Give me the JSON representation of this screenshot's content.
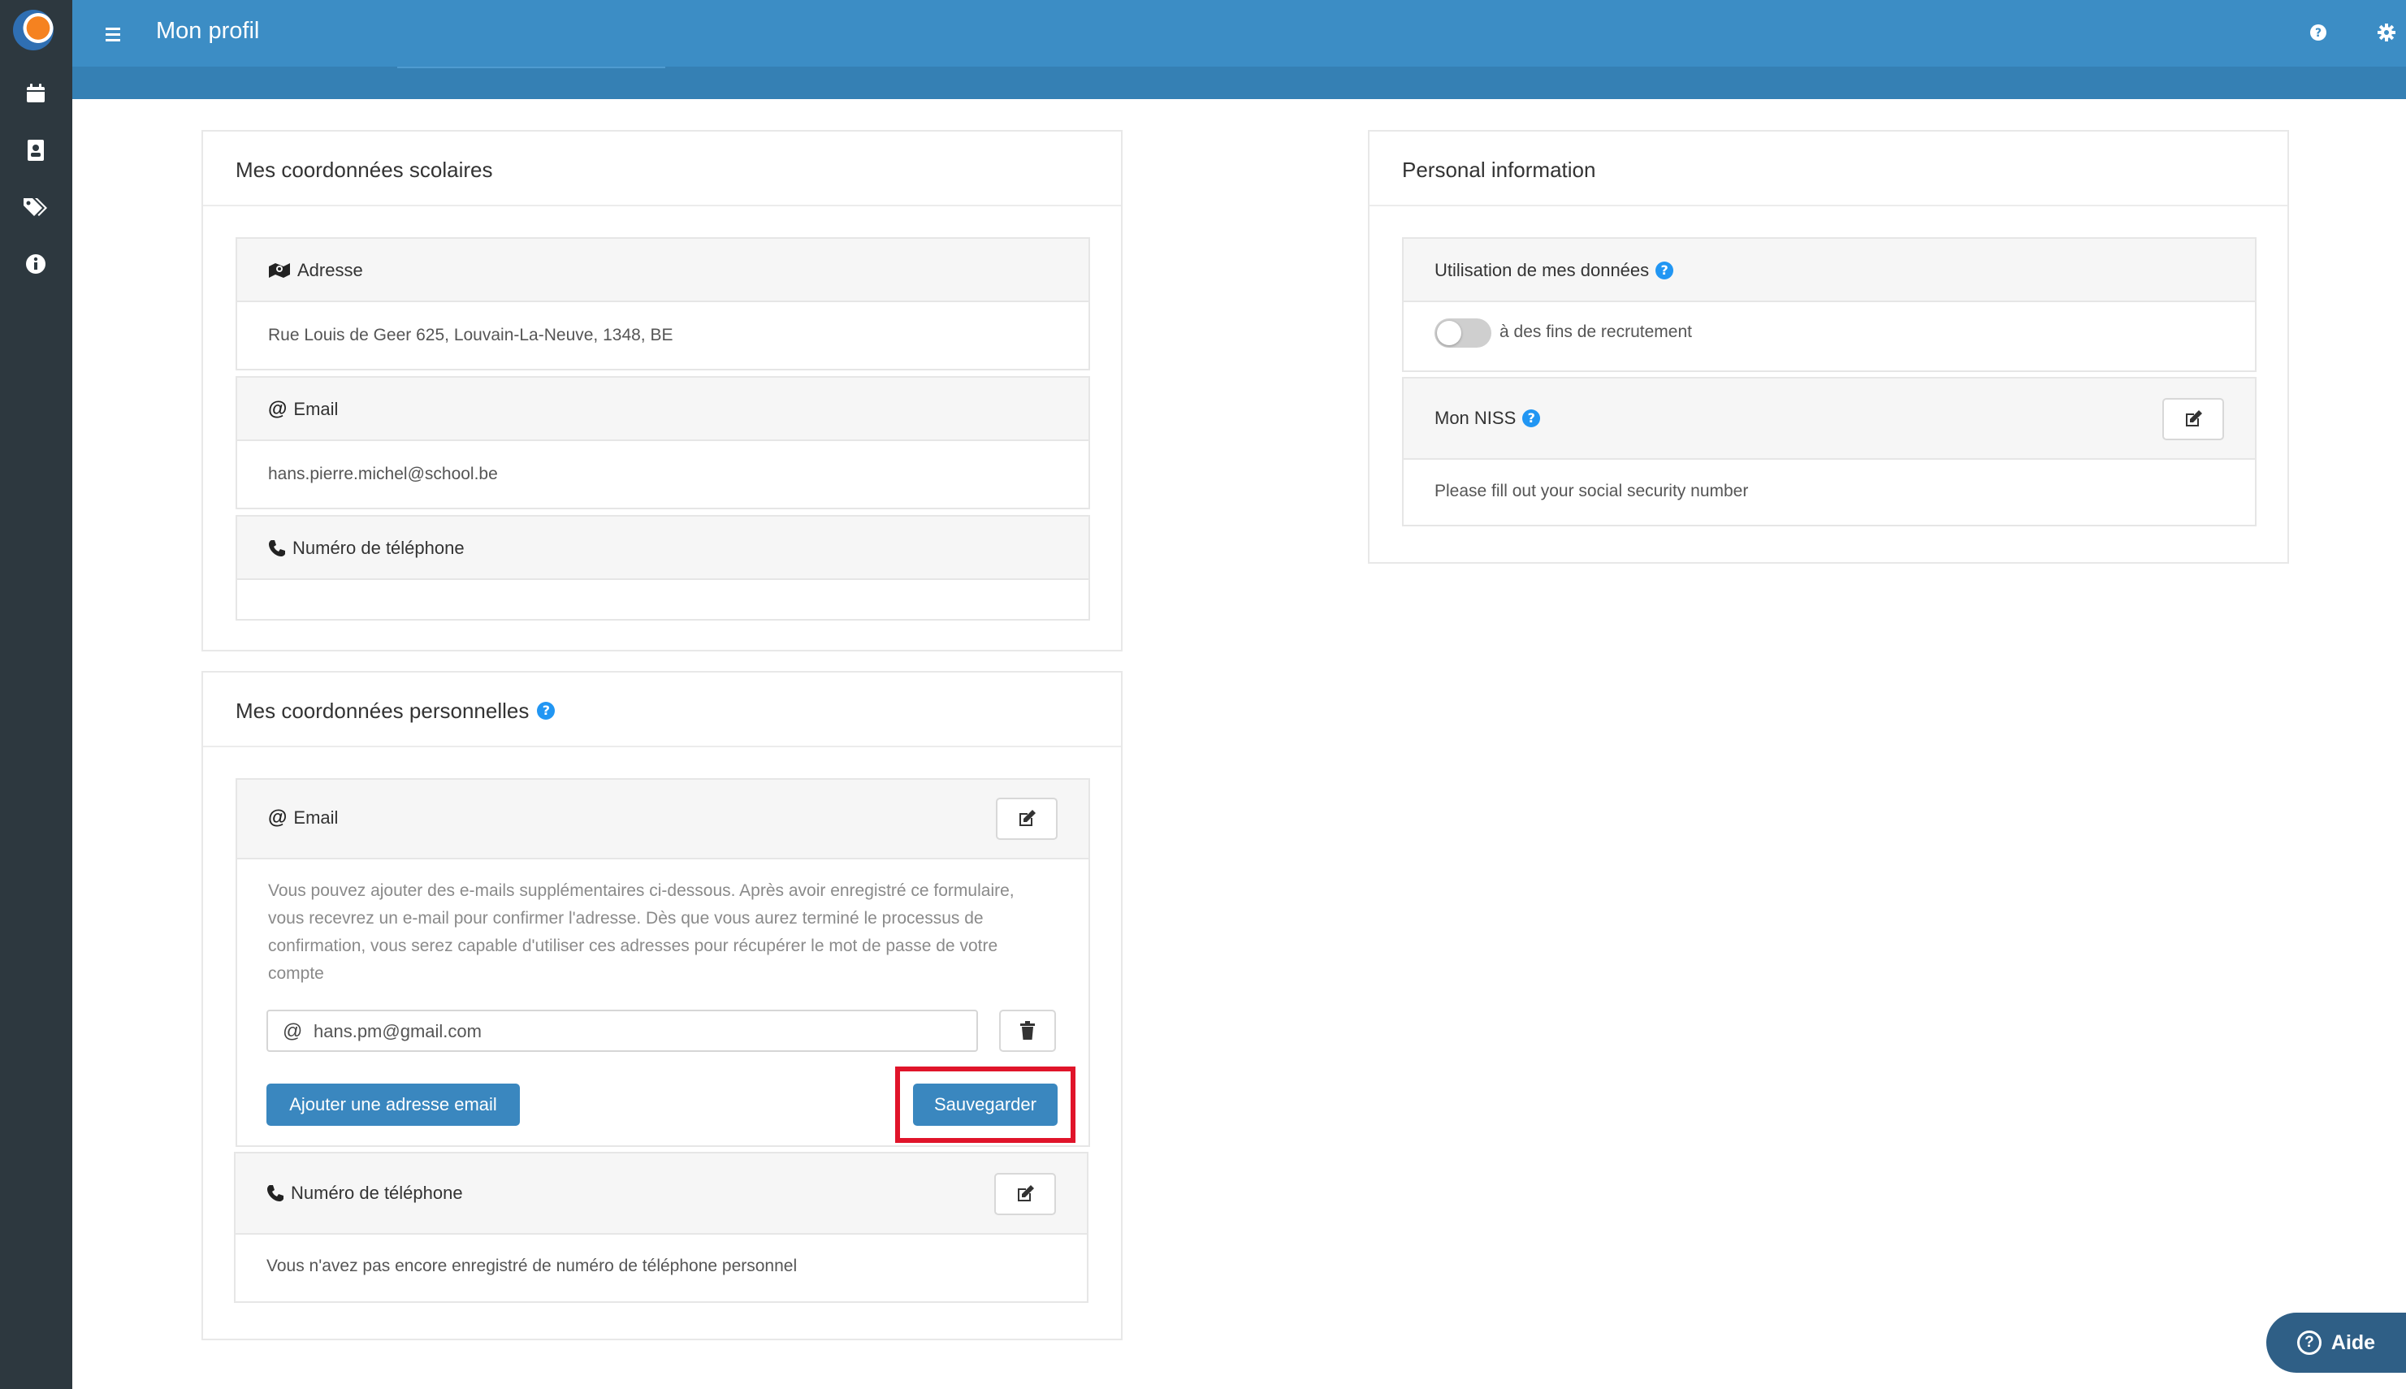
{
  "header": {
    "title": "Mon profil"
  },
  "colors": {
    "header": "#3c8dc5",
    "sidebar": "#2d383f",
    "primary_button": "#3a87bf",
    "highlight": "#e0142a",
    "info_icon": "#2196f3"
  },
  "sidebar": {
    "items": [
      {
        "icon": "calendar-icon"
      },
      {
        "icon": "contact-card-icon"
      },
      {
        "icon": "tags-icon"
      },
      {
        "icon": "info-circle-icon"
      }
    ]
  },
  "school_info": {
    "title": "Mes coordonnées scolaires",
    "address_label": "Adresse",
    "address_value": "Rue Louis de Geer 625, Louvain-La-Neuve, 1348, BE",
    "email_label": "Email",
    "email_value": "hans.pierre.michel@school.be",
    "phone_label": "Numéro de téléphone",
    "phone_value": ""
  },
  "personal_contact": {
    "title": "Mes coordonnées personnelles",
    "email_label": "Email",
    "email_help": "Vous pouvez ajouter des e-mails supplémentaires ci-dessous. Après avoir enregistré ce formulaire, vous recevrez un e-mail pour confirmer l'adresse. Dès que vous aurez terminé le processus de confirmation, vous serez capable d'utiliser ces adresses pour récupérer le mot de passe de votre compte",
    "email_input_symbol": "@",
    "email_input_value": "hans.pm@gmail.com",
    "add_email_label": "Ajouter une adresse email",
    "save_label": "Sauvegarder",
    "phone_label": "Numéro de téléphone",
    "phone_empty_text": "Vous n'avez pas encore enregistré de numéro de téléphone personnel"
  },
  "personal_info": {
    "title": "Personal information",
    "data_usage_label": "Utilisation de mes données",
    "recruitment_label": "à des fins de recrutement",
    "recruitment_enabled": false,
    "niss_label": "Mon NISS",
    "niss_text": "Please fill out your social security number"
  },
  "help_button": {
    "label": "Aide"
  }
}
